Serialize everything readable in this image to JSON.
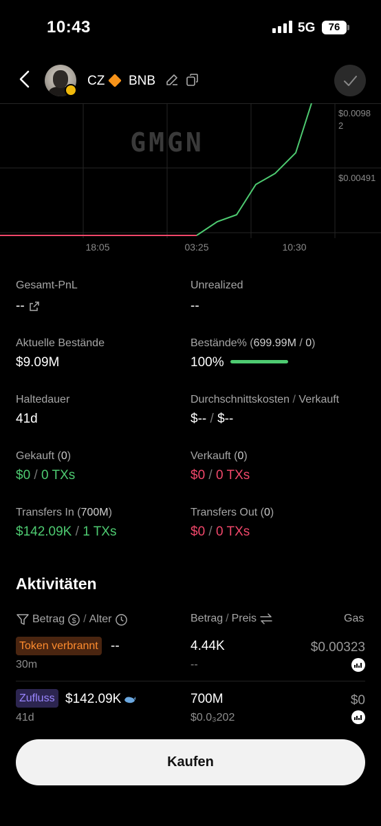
{
  "status_bar": {
    "time": "10:43",
    "network": "5G",
    "battery": "76"
  },
  "header": {
    "token_name": "CZ",
    "token_symbol": "BNB"
  },
  "chart": {
    "watermark": "GMGN",
    "y_labels": [
      "$0.0098",
      "2",
      "$0.00491"
    ],
    "x_labels": [
      "18:05",
      "03:25",
      "10:30"
    ],
    "line_colors": {
      "flat": "#f0476a",
      "rise": "#4ecb71"
    }
  },
  "stats": {
    "pnl_label": "Gesamt-PnL",
    "pnl_value": "--",
    "unrealized_label": "Unrealized",
    "unrealized_value": "--",
    "holdings_label": "Aktuelle Bestände",
    "holdings_value": "$9.09M",
    "holdings_pct_label": "Bestände%",
    "holdings_pct_amount": "699.99M",
    "holdings_pct_slash": "/",
    "holdings_pct_total": "0",
    "holdings_pct_value": "100%",
    "holdings_pct_fraction": 1.0,
    "hold_duration_label": "Haltedauer",
    "hold_duration_value": "41d",
    "avg_cost_label": "Durchschnittskosten",
    "avg_cost_sep": "/",
    "sold_label": "Verkauft",
    "avg_cost_value": "$--",
    "avg_slash": "/",
    "sold_value": "$--",
    "bought_label": "Gekauft",
    "bought_count": "0",
    "bought_usd": "$0",
    "bought_txs": "0 TXs",
    "sold2_label": "Verkauft",
    "sold2_count": "0",
    "sold2_usd": "$0",
    "sold2_txs": "0 TXs",
    "tin_label": "Transfers In",
    "tin_amount": "700M",
    "tin_usd": "$142.09K",
    "tin_txs": "1 TXs",
    "tout_label": "Transfers Out",
    "tout_count": "0",
    "tout_usd": "$0",
    "tout_txs": "0 TXs",
    "slash": "/"
  },
  "activities": {
    "title": "Aktivitäten",
    "col_amount": "Betrag",
    "col_age": "Alter",
    "col_amount2": "Betrag",
    "col_price": "Preis",
    "col_gas": "Gas",
    "slash": "/",
    "rows": [
      {
        "tag": "Token verbrannt",
        "usd": "--",
        "age": "30m",
        "amount": "4.44K",
        "price": "--",
        "gas": "$0.00323"
      },
      {
        "tag": "Zufluss",
        "usd": "$142.09K",
        "age": "41d",
        "amount": "700M",
        "price": "$0.0₃202",
        "gas": "$0"
      }
    ]
  },
  "buy_button": "Kaufen"
}
